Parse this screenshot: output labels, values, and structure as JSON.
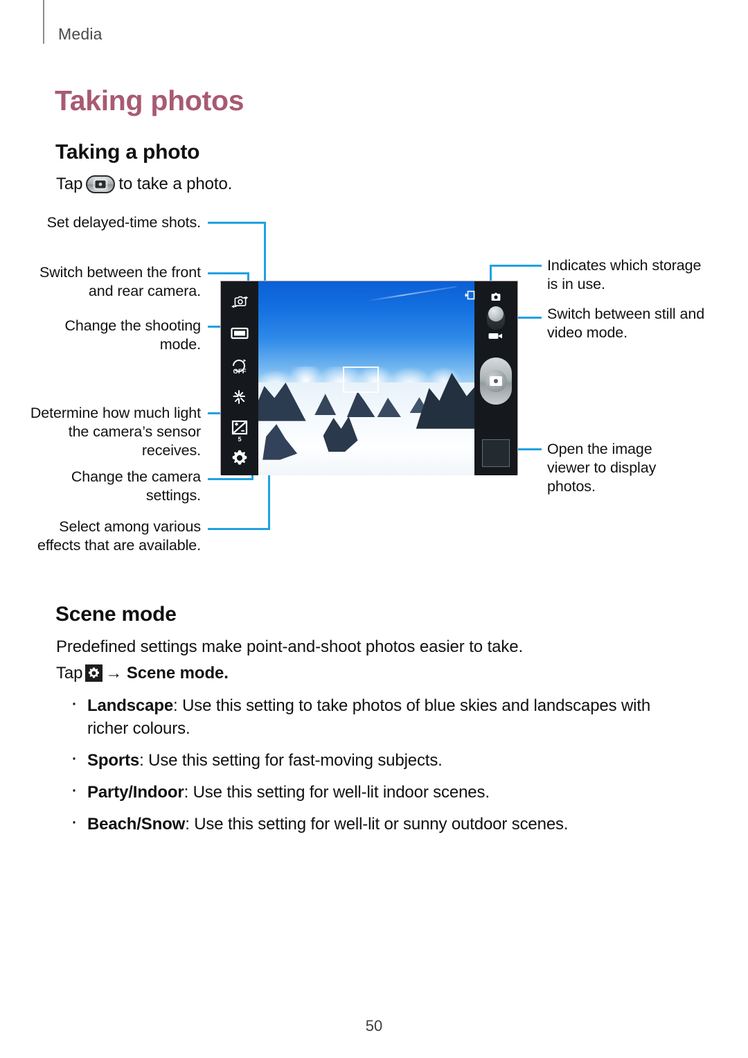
{
  "header": {
    "section_label": "Media"
  },
  "headings": {
    "h1": "Taking photos",
    "taking_a_photo": "Taking a photo",
    "scene_mode": "Scene mode"
  },
  "body": {
    "tap_prefix": "Tap",
    "tap_suffix": "to take a photo.",
    "shutter_icon": "camera-shutter-icon",
    "predefined": "Predefined settings make point-and-shoot photos easier to take.",
    "tap_scene_prefix": "Tap",
    "tap_scene_arrow": "→",
    "tap_scene_target": "Scene mode",
    "tap_scene_period": ".",
    "gear_icon": "gear-icon"
  },
  "diagram": {
    "callouts_left": [
      {
        "id": "delayed-time",
        "text": "Set delayed-time shots."
      },
      {
        "id": "switch-camera",
        "text": "Switch between the front and rear camera."
      },
      {
        "id": "shooting-mode",
        "text": "Change the shooting mode."
      },
      {
        "id": "exposure",
        "text": "Determine how much light the camera’s sensor receives."
      },
      {
        "id": "camera-settings",
        "text": "Change the camera settings."
      },
      {
        "id": "effects",
        "text": "Select among various effects that are available."
      }
    ],
    "callouts_right": [
      {
        "id": "storage-indicator",
        "text": "Indicates which storage is in use."
      },
      {
        "id": "still-video-toggle",
        "text": "Switch between still and video mode."
      },
      {
        "id": "image-viewer",
        "text": "Open the image viewer to display photos."
      }
    ],
    "toolbar_left_icons": [
      "switch-camera-icon",
      "shooting-mode-icon",
      "timer-off-icon",
      "effects-icon",
      "exposure-icon",
      "settings-gear-icon"
    ],
    "exposure_value": "5",
    "timer_label": "OFF",
    "toolbar_right_icons": [
      "storage-indicator-icon",
      "still-mode-icon",
      "video-mode-icon",
      "shutter-button",
      "gallery-thumbnail"
    ],
    "preview_scene": "snowy-mountain-landscape",
    "callout_line_color": "#1fa2e0"
  },
  "scene_modes": [
    {
      "term": "Landscape",
      "desc": ": Use this setting to take photos of blue skies and landscapes with richer colours."
    },
    {
      "term": "Sports",
      "desc": ": Use this setting for fast-moving subjects."
    },
    {
      "term": "Party/Indoor",
      "desc": ": Use this setting for well-lit indoor scenes."
    },
    {
      "term": "Beach/Snow",
      "desc": ": Use this setting for well-lit or sunny outdoor scenes."
    }
  ],
  "footer": {
    "page_number": "50"
  },
  "colors": {
    "title": "#a85a72",
    "callout_line": "#1fa2e0",
    "text": "#121212"
  }
}
